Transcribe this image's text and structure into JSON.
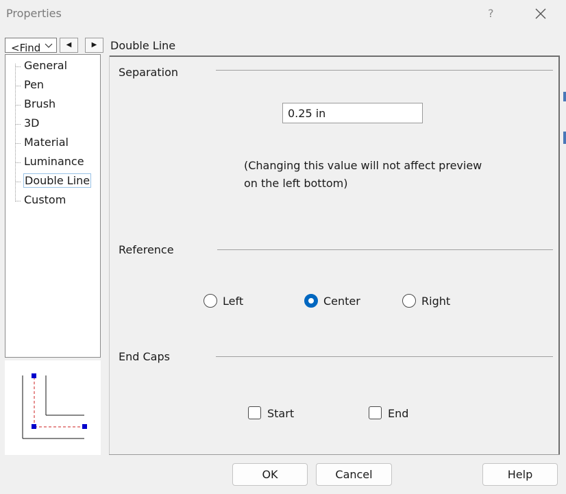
{
  "window": {
    "title": "Properties",
    "help_label": "?"
  },
  "nav": {
    "find_text": "<Find",
    "prev_glyph": "◀",
    "next_glyph": "▶"
  },
  "tree": {
    "items": [
      {
        "label": "General"
      },
      {
        "label": "Pen"
      },
      {
        "label": "Brush"
      },
      {
        "label": "3D"
      },
      {
        "label": "Material"
      },
      {
        "label": "Luminance"
      },
      {
        "label": "Double Line",
        "selected": true
      },
      {
        "label": "Custom"
      }
    ]
  },
  "panel": {
    "title": "Double Line",
    "separation": {
      "label": "Separation",
      "value": "0.25 in",
      "note_line1": "(Changing this value will not affect preview",
      "note_line2": "on the left bottom)"
    },
    "reference": {
      "label": "Reference",
      "options": [
        "Left",
        "Center",
        "Right"
      ],
      "selected": "Center"
    },
    "end_caps": {
      "label": "End Caps",
      "start_label": "Start",
      "end_label": "End",
      "start_checked": false,
      "end_checked": false
    }
  },
  "buttons": {
    "ok": "OK",
    "cancel": "Cancel",
    "help": "Help"
  },
  "colors": {
    "accent": "#0067c0",
    "preview_handle": "#0000cc",
    "preview_dash": "#cc2222"
  }
}
